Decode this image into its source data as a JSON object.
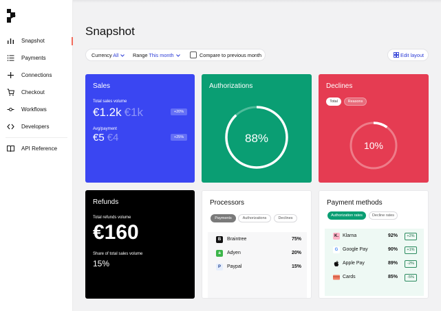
{
  "sidebar": {
    "items": [
      {
        "label": "Snapshot",
        "icon": "bar-chart-icon",
        "active": true
      },
      {
        "label": "Payments",
        "icon": "list-icon"
      },
      {
        "label": "Connections",
        "icon": "plus-icon"
      },
      {
        "label": "Checkout",
        "icon": "cart-icon"
      },
      {
        "label": "Workflows",
        "icon": "workflow-icon"
      },
      {
        "label": "Developers",
        "icon": "code-icon"
      },
      {
        "label": "API Reference",
        "icon": "book-icon"
      }
    ]
  },
  "page": {
    "title": "Snapshot"
  },
  "filters": {
    "currency_label": "Currency",
    "currency_value": "All",
    "range_label": "Range",
    "range_value": "This month",
    "compare_label": "Compare to previous month"
  },
  "edit_layout": {
    "label": "Edit layout"
  },
  "sales": {
    "title": "Sales",
    "volume_label": "Total sales volume",
    "volume_value": "€1.2k",
    "volume_prev": "€1k",
    "volume_change": "+20%",
    "avg_label": "Avg/payment",
    "avg_value": "€5",
    "avg_prev": "€4",
    "avg_change": "+25%"
  },
  "authorizations": {
    "title": "Authorizations",
    "value_label": "88%",
    "value": 0.88
  },
  "declines": {
    "title": "Declines",
    "tabs": [
      "Total",
      "Reasons"
    ],
    "value_label": "10%",
    "value": 0.1
  },
  "refunds": {
    "title": "Refunds",
    "volume_label": "Total refunds volume",
    "volume_value": "€160",
    "share_label": "Share of total sales volume",
    "share_value": "15%"
  },
  "processors": {
    "title": "Processors",
    "tabs": [
      "Payments",
      "Authorizations",
      "Declines"
    ],
    "rows": [
      {
        "name": "Braintree",
        "pct": "75%",
        "logo": "B",
        "logo_bg": "#111111",
        "logo_fg": "#ffffff"
      },
      {
        "name": "Adyen",
        "pct": "20%",
        "logo": "a",
        "logo_bg": "#3cb54a",
        "logo_fg": "#ffffff"
      },
      {
        "name": "Paypal",
        "pct": "15%",
        "logo": "P",
        "logo_bg": "#e6eefc",
        "logo_fg": "#1d3f8f"
      }
    ]
  },
  "payment_methods": {
    "title": "Payment methods",
    "tabs": [
      "Authorization rates",
      "Decline rates"
    ],
    "rows": [
      {
        "name": "Klarna",
        "pct": "92%",
        "delta": "+2%",
        "logo": "K.",
        "logo_bg": "#ffb3c7",
        "logo_fg": "#111111"
      },
      {
        "name": "Google Pay",
        "pct": "90%",
        "delta": "+1%",
        "logo": "G",
        "logo_bg": "#ffffff",
        "logo_fg": "#4285f4"
      },
      {
        "name": "Apple Pay",
        "pct": "89%",
        "delta": "-2%",
        "logo": "",
        "logo_bg": "#ffffff",
        "logo_fg": "#111111"
      },
      {
        "name": "Cards",
        "pct": "85%",
        "delta": "-5%",
        "logo": "",
        "logo_bg": "#f07e64",
        "logo_fg": "#ffffff"
      }
    ]
  },
  "colors": {
    "sales": "#3a46f2",
    "authorizations": "#0a9e73",
    "declines": "#e53c52",
    "refunds": "#000000",
    "accent_link": "#2a3ad6"
  }
}
